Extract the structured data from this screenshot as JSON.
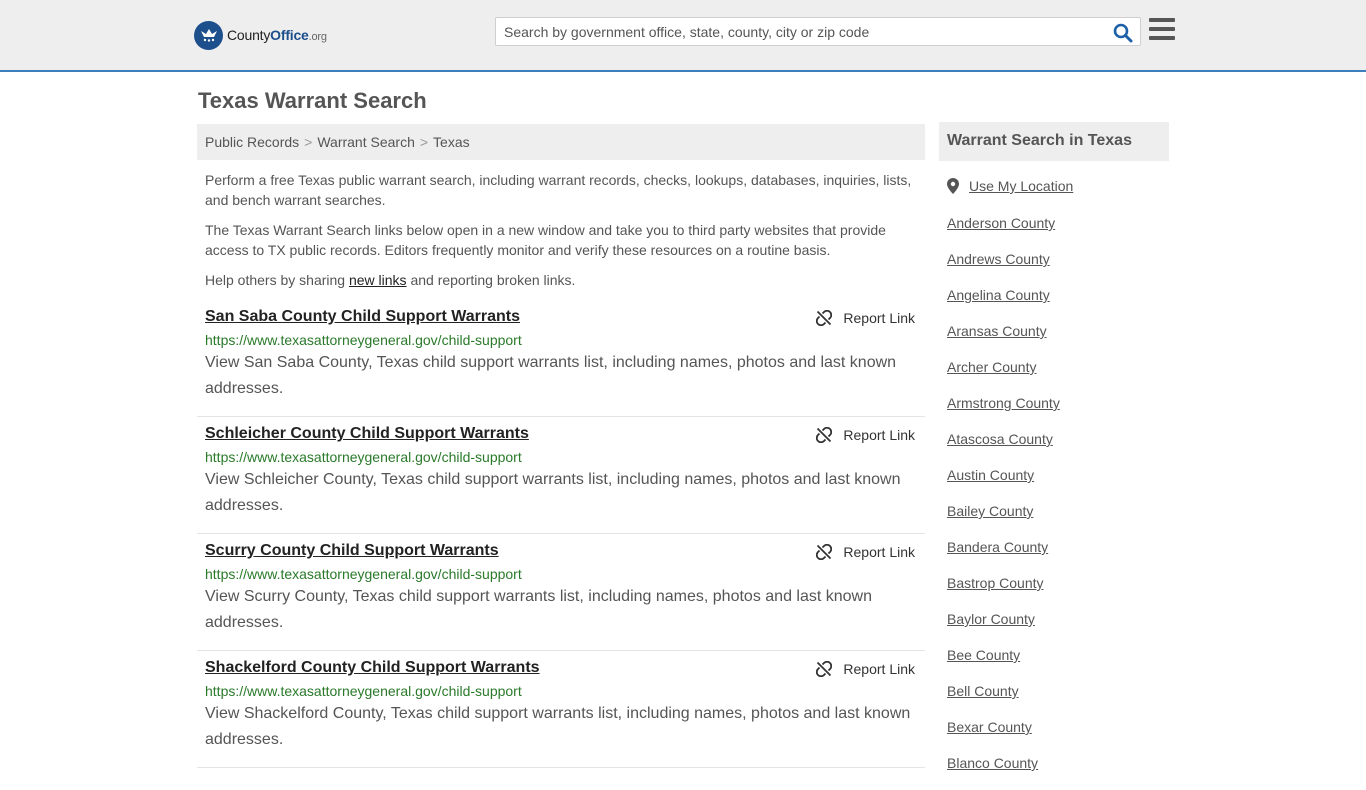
{
  "header": {
    "logo_main": "County",
    "logo_office": "Office",
    "logo_org": ".org",
    "search_placeholder": "Search by government office, state, county, city or zip code"
  },
  "page": {
    "title": "Texas Warrant Search"
  },
  "breadcrumb": [
    "Public Records",
    "Warrant Search",
    "Texas"
  ],
  "intro": {
    "p1": "Perform a free Texas public warrant search, including warrant records, checks, lookups, databases, inquiries, lists, and bench warrant searches.",
    "p2": "The Texas Warrant Search links below open in a new window and take you to third party websites that provide access to TX public records. Editors frequently monitor and verify these resources on a routine basis.",
    "p3_before": "Help others by sharing ",
    "p3_link": "new links",
    "p3_after": " and reporting broken links."
  },
  "report_label": "Report Link",
  "results": [
    {
      "title": "San Saba County Child Support Warrants",
      "url": "https://www.texasattorneygeneral.gov/child-support",
      "desc": "View San Saba County, Texas child support warrants list, including names, photos and last known addresses."
    },
    {
      "title": "Schleicher County Child Support Warrants",
      "url": "https://www.texasattorneygeneral.gov/child-support",
      "desc": "View Schleicher County, Texas child support warrants list, including names, photos and last known addresses."
    },
    {
      "title": "Scurry County Child Support Warrants",
      "url": "https://www.texasattorneygeneral.gov/child-support",
      "desc": "View Scurry County, Texas child support warrants list, including names, photos and last known addresses."
    },
    {
      "title": "Shackelford County Child Support Warrants",
      "url": "https://www.texasattorneygeneral.gov/child-support",
      "desc": "View Shackelford County, Texas child support warrants list, including names, photos and last known addresses."
    }
  ],
  "sidebar": {
    "heading": "Warrant Search in Texas",
    "use_location": "Use My Location",
    "counties": [
      "Anderson County",
      "Andrews County",
      "Angelina County",
      "Aransas County",
      "Archer County",
      "Armstrong County",
      "Atascosa County",
      "Austin County",
      "Bailey County",
      "Bandera County",
      "Bastrop County",
      "Baylor County",
      "Bee County",
      "Bell County",
      "Bexar County",
      "Blanco County"
    ]
  },
  "colors": {
    "accent": "#1d4f8c",
    "url_green": "#2a7a2a",
    "header_bg": "#eeeeee"
  }
}
